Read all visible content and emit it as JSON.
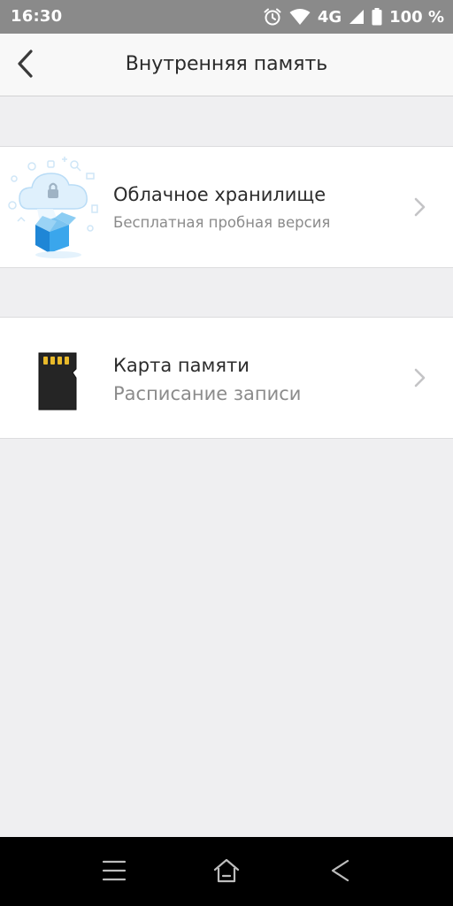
{
  "status_bar": {
    "time": "16:30",
    "network": "4G",
    "battery": "100 %",
    "icons": [
      "alarm-icon",
      "wifi-icon",
      "signal-icon",
      "battery-icon"
    ]
  },
  "header": {
    "title": "Внутренняя память",
    "back_icon": "chevron-left-icon"
  },
  "items": [
    {
      "title": "Облачное хранилище",
      "subtitle": "Бесплатная пробная версия",
      "icon": "cloud-storage-icon"
    },
    {
      "title": "Карта памяти",
      "subtitle": "Расписание записи",
      "icon": "sd-card-icon"
    }
  ],
  "nav_bar": {
    "icons": [
      "menu-icon",
      "home-icon",
      "back-triangle-icon"
    ]
  },
  "colors": {
    "status_bar": "#8a8a8a",
    "header_bg": "#f8f8f8",
    "page_bg": "#efeff1",
    "card_bg": "#ffffff",
    "title_text": "#2c2c2c",
    "subtitle_text": "#8b8b8b",
    "cloud_blue": "#2b9be3"
  }
}
